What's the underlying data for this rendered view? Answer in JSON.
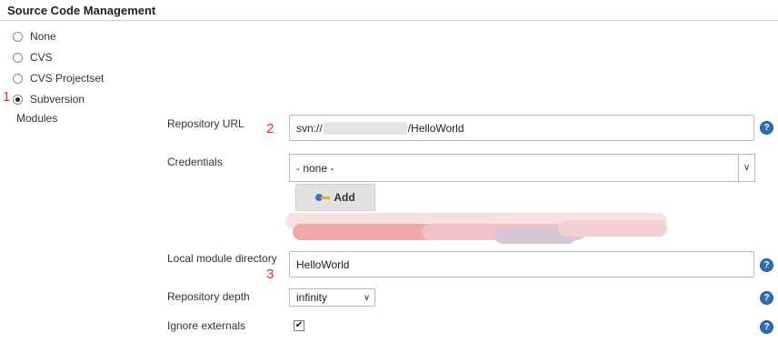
{
  "section": {
    "title": "Source Code Management"
  },
  "scm_options": [
    {
      "label": "None",
      "checked": false
    },
    {
      "label": "CVS",
      "checked": false
    },
    {
      "label": "CVS Projectset",
      "checked": false
    },
    {
      "label": "Subversion",
      "checked": true
    }
  ],
  "modules_label": "Modules",
  "markers": [
    "1",
    "2",
    "3"
  ],
  "repository_url": {
    "label": "Repository URL",
    "value_prefix": "svn://",
    "value_suffix": "/HelloWorld"
  },
  "credentials": {
    "label": "Credentials",
    "selected": "- none -",
    "add_button": "Add"
  },
  "local_module_directory": {
    "label": "Local module directory",
    "value": "HelloWorld"
  },
  "repository_depth": {
    "label": "Repository depth",
    "selected": "infinity"
  },
  "ignore_externals": {
    "label": "Ignore externals",
    "checked": true,
    "check_glyph": "✔"
  },
  "help_glyph": "?",
  "icons": {
    "help": "help-icon",
    "add": "key-icon",
    "dropdown": "chevron-down-icon"
  },
  "colors": {
    "marker": "#e0302a",
    "help": "#2f6db5"
  }
}
